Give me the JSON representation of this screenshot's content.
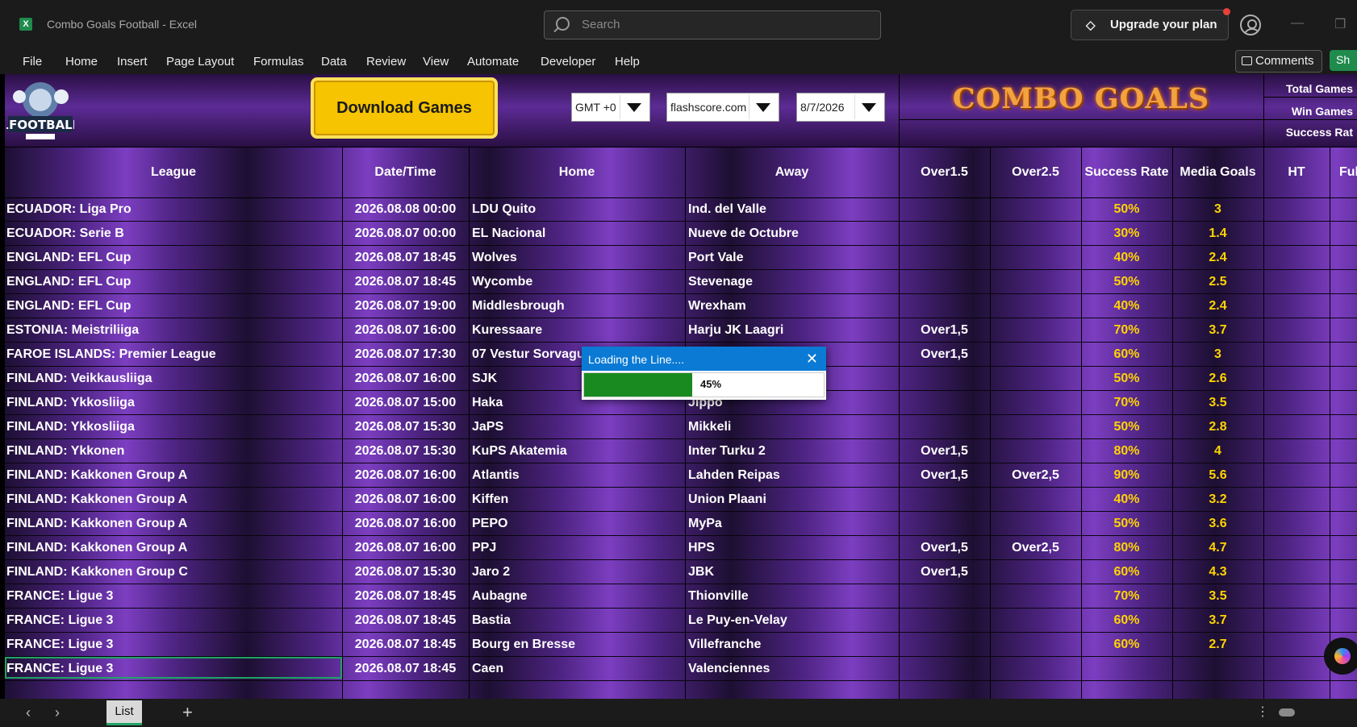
{
  "window": {
    "title": "Combo Goals Football",
    "app": "Excel",
    "separator": "-"
  },
  "search": {
    "placeholder": "Search"
  },
  "upgrade": {
    "label": "Upgrade your plan"
  },
  "menu": [
    "File",
    "Home",
    "Insert",
    "Page Layout",
    "Formulas",
    "Data",
    "Review",
    "View",
    "Automate",
    "Developer",
    "Help"
  ],
  "ribbon_right": {
    "comments": "Comments",
    "share": "Sh"
  },
  "sheet_header": {
    "download_label": "Download Games",
    "timezone": "GMT +0",
    "source": "flashscore.com",
    "date": "8/7/2026",
    "banner": "COMBO GOALS",
    "stats": [
      "Total Games",
      "Win Games",
      "Success Rat"
    ]
  },
  "columns": [
    "League",
    "Date/Time",
    "Home",
    "Away",
    "Over1.5",
    "Over2.5",
    "Success Rate",
    "Media Goals",
    "HT",
    "Full"
  ],
  "rows": [
    [
      "ECUADOR: Liga Pro",
      "2026.08.08 00:00",
      "LDU Quito",
      "Ind. del Valle",
      "",
      "",
      "50%",
      "3"
    ],
    [
      "ECUADOR: Serie B",
      "2026.08.07 00:00",
      "EL Nacional",
      "Nueve de Octubre",
      "",
      "",
      "30%",
      "1.4"
    ],
    [
      "ENGLAND: EFL Cup",
      "2026.08.07 18:45",
      "Wolves",
      "Port Vale",
      "",
      "",
      "40%",
      "2.4"
    ],
    [
      "ENGLAND: EFL Cup",
      "2026.08.07 18:45",
      "Wycombe",
      "Stevenage",
      "",
      "",
      "50%",
      "2.5"
    ],
    [
      "ENGLAND: EFL Cup",
      "2026.08.07 19:00",
      "Middlesbrough",
      "Wrexham",
      "",
      "",
      "40%",
      "2.4"
    ],
    [
      "ESTONIA: Meistriliiga",
      "2026.08.07 16:00",
      "Kuressaare",
      "Harju JK Laagri",
      "Over1,5",
      "",
      "70%",
      "3.7"
    ],
    [
      "FAROE ISLANDS: Premier League",
      "2026.08.07 17:30",
      "07 Vestur Sorvagur",
      "",
      "Over1,5",
      "",
      "60%",
      "3"
    ],
    [
      "FINLAND: Veikkausliiga",
      "2026.08.07 16:00",
      "SJK",
      "",
      "",
      "",
      "50%",
      "2.6"
    ],
    [
      "FINLAND: Ykkosliiga",
      "2026.08.07 15:00",
      "Haka",
      "Jippo",
      "",
      "",
      "70%",
      "3.5"
    ],
    [
      "FINLAND: Ykkosliiga",
      "2026.08.07 15:30",
      "JaPS",
      "Mikkeli",
      "",
      "",
      "50%",
      "2.8"
    ],
    [
      "FINLAND: Ykkonen",
      "2026.08.07 15:30",
      "KuPS Akatemia",
      "Inter Turku 2",
      "Over1,5",
      "",
      "80%",
      "4"
    ],
    [
      "FINLAND: Kakkonen Group A",
      "2026.08.07 16:00",
      "Atlantis",
      "Lahden Reipas",
      "Over1,5",
      "Over2,5",
      "90%",
      "5.6"
    ],
    [
      "FINLAND: Kakkonen Group A",
      "2026.08.07 16:00",
      "Kiffen",
      "Union Plaani",
      "",
      "",
      "40%",
      "3.2"
    ],
    [
      "FINLAND: Kakkonen Group A",
      "2026.08.07 16:00",
      "PEPO",
      "MyPa",
      "",
      "",
      "50%",
      "3.6"
    ],
    [
      "FINLAND: Kakkonen Group A",
      "2026.08.07 16:00",
      "PPJ",
      "HPS",
      "Over1,5",
      "Over2,5",
      "80%",
      "4.7"
    ],
    [
      "FINLAND: Kakkonen Group C",
      "2026.08.07 15:30",
      "Jaro 2",
      "JBK",
      "Over1,5",
      "",
      "60%",
      "4.3"
    ],
    [
      "FRANCE: Ligue 3",
      "2026.08.07 18:45",
      "Aubagne",
      "Thionville",
      "",
      "",
      "70%",
      "3.5"
    ],
    [
      "FRANCE: Ligue 3",
      "2026.08.07 18:45",
      "Bastia",
      "Le Puy-en-Velay",
      "",
      "",
      "60%",
      "3.7"
    ],
    [
      "FRANCE: Ligue 3",
      "2026.08.07 18:45",
      "Bourg en Bresse",
      "Villefranche",
      "",
      "",
      "60%",
      "2.7"
    ],
    [
      "FRANCE: Ligue 3",
      "2026.08.07 18:45",
      "Caen",
      "Valenciennes",
      "",
      "",
      "",
      ""
    ]
  ],
  "loader": {
    "title": "Loading the Line....",
    "percent_label": "45%",
    "progress": 0.45
  },
  "statusbar": {
    "sheet_tab": "List"
  },
  "colors": {
    "accent": "#21a366",
    "banner": "#f2a341",
    "highlight": "#ffd400",
    "button": "#f6c400",
    "progress": "#198a20"
  }
}
